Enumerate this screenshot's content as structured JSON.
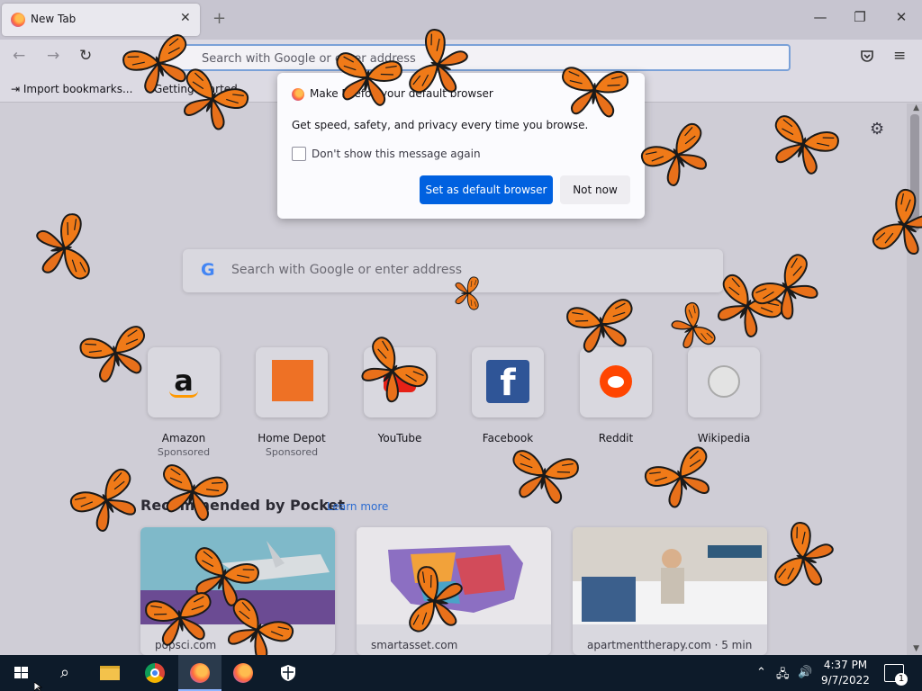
{
  "browser": {
    "tab_title": "New Tab",
    "tab_close": "✕",
    "new_tab": "+",
    "window_minimize": "—",
    "window_restore": "❐",
    "window_close": "✕",
    "back_icon": "arrow-left-icon",
    "forward_icon": "arrow-right-icon",
    "reload_icon": "reload-icon",
    "url_placeholder": "Search with Google or enter address",
    "pocket_icon": "pocket-icon",
    "menu_icon": "hamburger-menu-icon",
    "bookmarks": {
      "import_label": "Import bookmarks...",
      "getting_started": "Getting Started"
    }
  },
  "dialog": {
    "title": "Make Firefox your default browser",
    "body": "Get speed, safety, and privacy every time you browse.",
    "checkbox_label": "Don't show this message again",
    "checkbox_checked": false,
    "primary_button": "Set as default browser",
    "secondary_button": "Not now",
    "primary_color": "#0061e0"
  },
  "newtab": {
    "search_placeholder": "Search with Google or enter address",
    "top_sites": [
      {
        "label": "Amazon",
        "sub": "Sponsored",
        "icon": "amazon-icon"
      },
      {
        "label": "Home Depot",
        "sub": "Sponsored",
        "icon": "home-depot-icon"
      },
      {
        "label": "YouTube",
        "sub": "",
        "icon": "youtube-icon"
      },
      {
        "label": "Facebook",
        "sub": "",
        "icon": "facebook-icon"
      },
      {
        "label": "Reddit",
        "sub": "",
        "icon": "reddit-icon"
      },
      {
        "label": "Wikipedia",
        "sub": "",
        "icon": "wikipedia-icon"
      }
    ],
    "pocket_title": "Recommended by Pocket",
    "pocket_learn_more": "Learn more",
    "cards": [
      {
        "source": "popsci.com"
      },
      {
        "source": "smartasset.com"
      },
      {
        "source": "apartmenttherapy.com · 5 min"
      }
    ]
  },
  "taskbar": {
    "time": "4:37 PM",
    "date": "9/7/2022",
    "notification_count": "1",
    "apps": [
      "start-icon",
      "search-icon",
      "file-explorer-icon",
      "chrome-icon",
      "firefox-icon",
      "firefox-icon",
      "security-shield-icon"
    ]
  }
}
